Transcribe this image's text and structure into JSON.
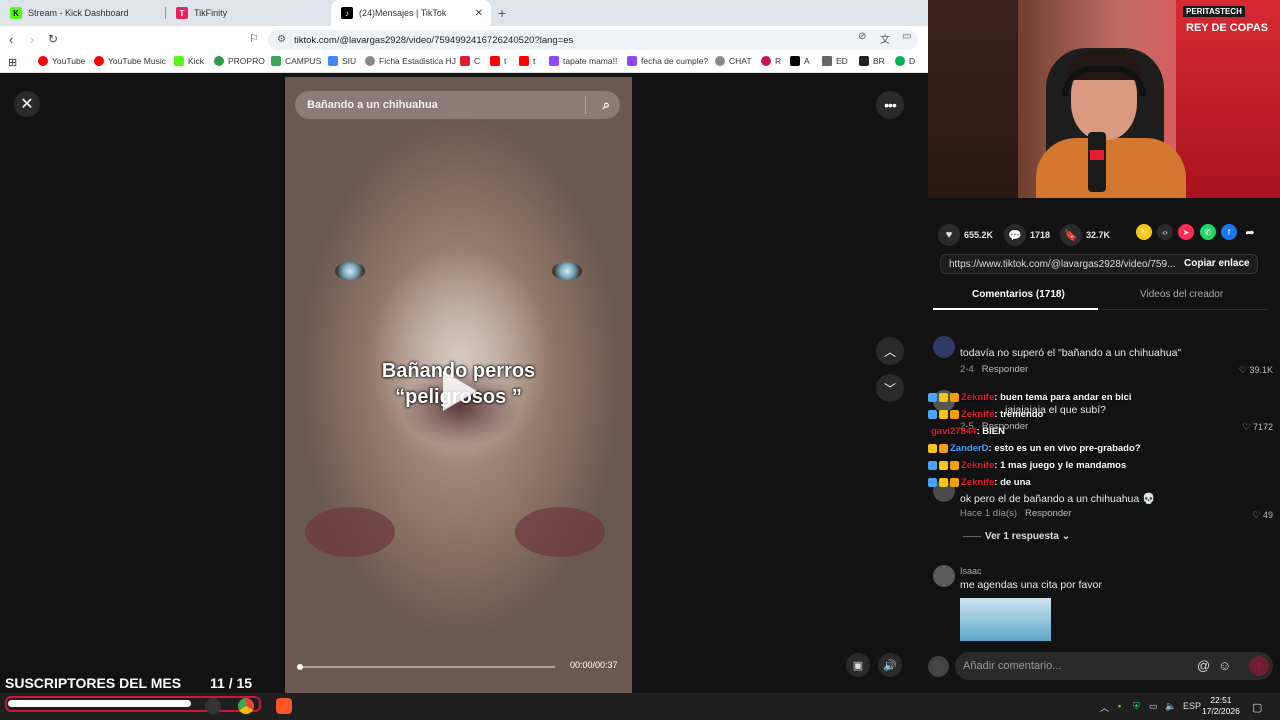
{
  "browser": {
    "tabs": [
      {
        "label": "Stream - Kick Dashboard",
        "favicon": "kick-icon",
        "color": "#53fc18"
      },
      {
        "label": "TikFinity",
        "favicon": "tikfinity-icon",
        "color": "#e5245e"
      },
      {
        "label": "(24)Mensajes | TikTok",
        "favicon": "tiktok-icon",
        "color": "#000000"
      }
    ],
    "url": "tiktok.com/@lavargas2928/video/7594992416726240520?lang=es",
    "bookmarks": [
      {
        "label": "YouTube",
        "color": "#ff0000"
      },
      {
        "label": "YouTube Music",
        "color": "#ff0000"
      },
      {
        "label": "Kick",
        "color": "#53fc18"
      },
      {
        "label": "PROPRO",
        "color": "#2e9e44"
      },
      {
        "label": "CAMPUS",
        "color": "#34a853"
      },
      {
        "label": "SIU",
        "color": "#4285f4"
      },
      {
        "label": "Ficha Estadistica HJ",
        "color": "#888888"
      },
      {
        "label": "C",
        "color": "#e21c2f"
      },
      {
        "label": "t",
        "color": "#ff0000"
      },
      {
        "label": "t",
        "color": "#ff0000"
      },
      {
        "label": "tapate mama!!",
        "color": "#9146ff"
      },
      {
        "label": "fecha de cumple?",
        "color": "#9146ff"
      },
      {
        "label": "CHAT",
        "color": "#888888"
      },
      {
        "label": "R",
        "color": "#c2185b"
      },
      {
        "label": "A",
        "color": "#000000"
      },
      {
        "label": "ED",
        "color": "#666666"
      },
      {
        "label": "BR",
        "color": "#222222"
      },
      {
        "label": "D",
        "color": "#00b050"
      }
    ]
  },
  "video": {
    "search_placeholder": "Bañando a un chihuahua",
    "overlay_line1": "Bañando perros",
    "overlay_line2": "“peligrosos ”",
    "time": "00:00/00:37",
    "progress": 0
  },
  "webcam": {
    "banner_top": "PERITASTECH",
    "banner_sub": "REY DE COPAS"
  },
  "stats": {
    "likes": "655.2K",
    "comments": "1718",
    "saves": "32.7K"
  },
  "share": {
    "link": "https://www.tiktok.com/@lavargas2928/video/759...",
    "copy_label": "Copiar enlace"
  },
  "panel_tabs": {
    "comments": "Comentarios (1718)",
    "creator_videos": "Videos del creador"
  },
  "comments": [
    {
      "user": "",
      "text": "todavía no superó el \"bañando a un chihuahua\"",
      "date": "2-4",
      "reply": "Responder",
      "likes": "39.1K"
    },
    {
      "user": "",
      "text": "jajajajaja el que subí?",
      "date": "2-5",
      "reply": "Responder",
      "likes": "7172"
    },
    {
      "user": "",
      "text": "ok pero el de bañando a un chihuahua 💀",
      "date": "Hace 1 día(s)",
      "reply": "Responder",
      "likes": "49",
      "replies": "Ver 1 respuesta"
    },
    {
      "user": "Isaac",
      "text": "me agendas una cita por favor",
      "date": "",
      "reply": "",
      "likes": ""
    }
  ],
  "chat": [
    {
      "user": "Zeknife",
      "user_color": "#e21c2f",
      "message": ": buen tema para andar en bici"
    },
    {
      "user": "Zeknife",
      "user_color": "#e21c2f",
      "message": ": tremendo"
    },
    {
      "user": "gavi27844",
      "user_color": "#e21c2f",
      "message": ": BIEN"
    },
    {
      "user": "ZanderD",
      "user_color": "#4aa3ff",
      "message": ": esto es un en vivo pre-grabado?"
    },
    {
      "user": "Zeknife",
      "user_color": "#e21c2f",
      "message": ": 1 mas juego y le mandamos"
    },
    {
      "user": "Zeknife",
      "user_color": "#e21c2f",
      "message": ": de una"
    }
  ],
  "comment_input": {
    "placeholder": "Añadir comentario..."
  },
  "overlay": {
    "subs_label": "SUSCRIPTORES DEL MES",
    "subs_count": "11  / 15",
    "subs_fraction": 0.733
  },
  "taskbar": {
    "lang": "ESP",
    "time": "22:51",
    "date": "17/2/2026"
  }
}
